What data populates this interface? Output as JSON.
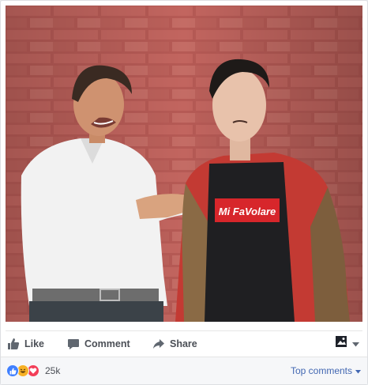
{
  "post": {
    "photo": {
      "alt_icon": "photo-of-two-men-at-brick-wall",
      "shirt_text": "Mi FaVolare"
    },
    "actions": {
      "like_label": "Like",
      "comment_label": "Comment",
      "share_label": "Share"
    },
    "audience_icon": "audience-selector-icon",
    "reactions": {
      "types": [
        "like",
        "haha",
        "love"
      ],
      "count": "25k"
    },
    "top_comments_label": "Top comments"
  },
  "colors": {
    "like_blue": "#4080ff",
    "haha_yellow": "#f7b125",
    "love_red": "#f33e58",
    "link_blue": "#4267b2",
    "shirt_red": "#d7262b"
  }
}
